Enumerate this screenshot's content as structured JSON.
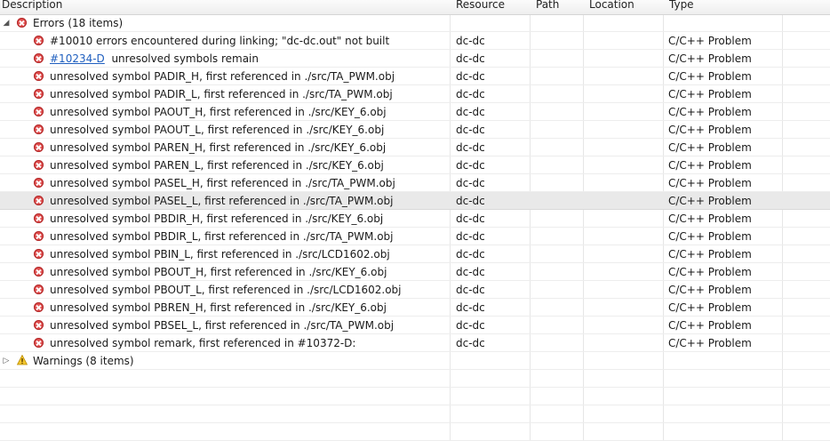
{
  "columns": {
    "description": "Description",
    "resource": "Resource",
    "path": "Path",
    "location": "Location",
    "type": "Type"
  },
  "errors_group": {
    "label": "Errors (18 items)"
  },
  "warnings_group": {
    "label": "Warnings (8 items)"
  },
  "rows": [
    {
      "desc": "#10010 errors encountered during linking; \"dc-dc.out\" not built",
      "resource": "dc-dc",
      "type": "C/C++ Problem"
    },
    {
      "link": "#10234-D",
      "desc": "unresolved symbols remain",
      "resource": "dc-dc",
      "type": "C/C++ Problem"
    },
    {
      "desc": "unresolved symbol PADIR_H, first referenced in ./src/TA_PWM.obj",
      "resource": "dc-dc",
      "type": "C/C++ Problem"
    },
    {
      "desc": "unresolved symbol PADIR_L, first referenced in ./src/TA_PWM.obj",
      "resource": "dc-dc",
      "type": "C/C++ Problem"
    },
    {
      "desc": "unresolved symbol PAOUT_H, first referenced in ./src/KEY_6.obj",
      "resource": "dc-dc",
      "type": "C/C++ Problem"
    },
    {
      "desc": "unresolved symbol PAOUT_L, first referenced in ./src/KEY_6.obj",
      "resource": "dc-dc",
      "type": "C/C++ Problem"
    },
    {
      "desc": "unresolved symbol PAREN_H, first referenced in ./src/KEY_6.obj",
      "resource": "dc-dc",
      "type": "C/C++ Problem"
    },
    {
      "desc": "unresolved symbol PAREN_L, first referenced in ./src/KEY_6.obj",
      "resource": "dc-dc",
      "type": "C/C++ Problem"
    },
    {
      "desc": "unresolved symbol PASEL_H, first referenced in ./src/TA_PWM.obj",
      "resource": "dc-dc",
      "type": "C/C++ Problem"
    },
    {
      "desc": "unresolved symbol PASEL_L, first referenced in ./src/TA_PWM.obj",
      "resource": "dc-dc",
      "type": "C/C++ Problem"
    },
    {
      "desc": "unresolved symbol PBDIR_H, first referenced in ./src/KEY_6.obj",
      "resource": "dc-dc",
      "type": "C/C++ Problem"
    },
    {
      "desc": "unresolved symbol PBDIR_L, first referenced in ./src/TA_PWM.obj",
      "resource": "dc-dc",
      "type": "C/C++ Problem"
    },
    {
      "desc": "unresolved symbol PBIN_L, first referenced in ./src/LCD1602.obj",
      "resource": "dc-dc",
      "type": "C/C++ Problem"
    },
    {
      "desc": "unresolved symbol PBOUT_H, first referenced in ./src/KEY_6.obj",
      "resource": "dc-dc",
      "type": "C/C++ Problem"
    },
    {
      "desc": "unresolved symbol PBOUT_L, first referenced in ./src/LCD1602.obj",
      "resource": "dc-dc",
      "type": "C/C++ Problem"
    },
    {
      "desc": "unresolved symbol PBREN_H, first referenced in ./src/KEY_6.obj",
      "resource": "dc-dc",
      "type": "C/C++ Problem"
    },
    {
      "desc": "unresolved symbol PBSEL_L, first referenced in ./src/TA_PWM.obj",
      "resource": "dc-dc",
      "type": "C/C++ Problem"
    },
    {
      "desc": "unresolved symbol remark, first referenced in #10372-D:",
      "resource": "dc-dc",
      "type": "C/C++ Problem"
    }
  ]
}
